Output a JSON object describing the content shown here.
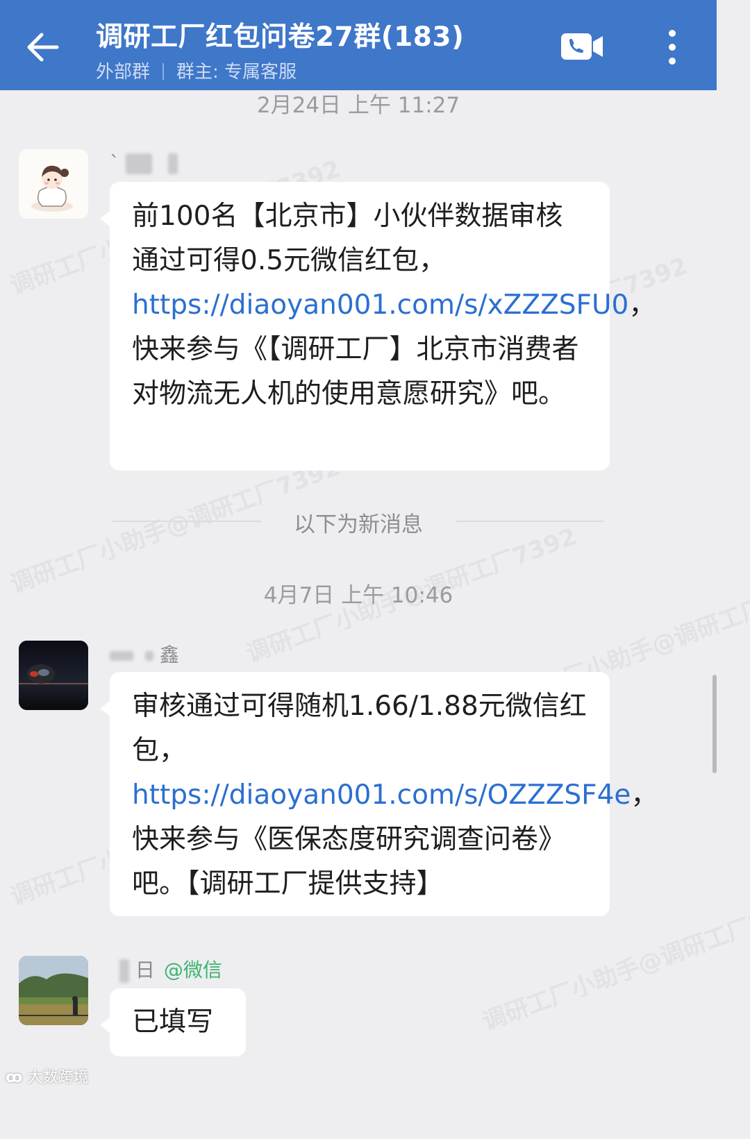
{
  "header": {
    "title": "调研工厂红包问卷27群(183)",
    "group_type": "外部群",
    "owner": "群主: 专属客服"
  },
  "watermark": "调研工厂小助手@调研工厂7392",
  "messages": {
    "ts1": "2月24日  上午 11:27",
    "m1_sender": "`",
    "m1_text_a": "前100名【北京市】小伙伴数据审核通过可得0.5元微信红包，",
    "m1_link": "https://diaoyan001.com/s/xZZZSFU0",
    "m1_text_b": "，快来参与《【调研工厂】北京市消费者对物流无人机的使用意愿研究》吧。",
    "new_label": "以下为新消息",
    "ts2": "4月7日  上午 10:46",
    "m2_sender": "鑫",
    "m2_text_a": "审核通过可得随机1.66/1.88元微信红包，",
    "m2_link": "https://diaoyan001.com/s/OZZZSF4e",
    "m2_text_b": "，快来参与《医保态度研究调查问卷》吧。【调研工厂提供支持】",
    "m3_sender": "日",
    "m3_source": "@微信",
    "m3_text": "已填写"
  },
  "corner_logo": "大数跨境",
  "colors": {
    "header_bg": "#3f77c9",
    "link": "#2b6fd0",
    "chat_bg": "#eeeef0",
    "wechat_green": "#3cb371"
  }
}
